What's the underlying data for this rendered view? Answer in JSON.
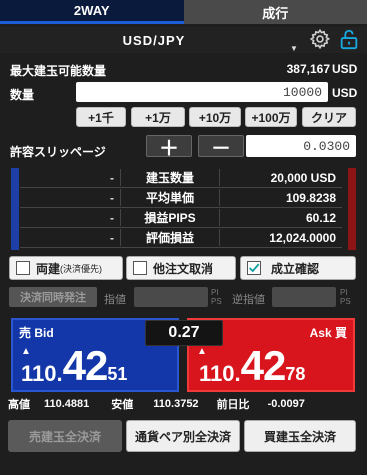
{
  "tabs": {
    "two_way": "2WAY",
    "market": "成行"
  },
  "pair": {
    "name": "USD/JPY"
  },
  "colors": {
    "bid": "#1337a8",
    "ask": "#d8141c",
    "tab_active": "#1c5cd8"
  },
  "icons": {
    "settings": "gear-icon",
    "lock": "lock-open-icon"
  },
  "max_qty": {
    "label": "最大建玉可能数量",
    "value": "387,167",
    "unit": "USD"
  },
  "qty": {
    "label": "数量",
    "value": "10000",
    "unit": "USD",
    "buttons": [
      "+1千",
      "+1万",
      "+10万",
      "+100万"
    ],
    "clear": "クリア"
  },
  "slippage": {
    "label": "許容スリッページ",
    "plus": "＋",
    "minus": "－",
    "value": "0.0300"
  },
  "info": [
    {
      "dash": "-",
      "label": "建玉数量",
      "value": "20,000 USD"
    },
    {
      "dash": "-",
      "label": "平均単価",
      "value": "109.8238"
    },
    {
      "dash": "-",
      "label": "損益PIPS",
      "value": "60.12"
    },
    {
      "dash": "-",
      "label": "評価損益",
      "value": "12,024.0000"
    }
  ],
  "options": {
    "both": {
      "label": "両建",
      "sub": "(決済優先)",
      "checked": false
    },
    "cancel_other": {
      "label": "他注文取消",
      "checked": false
    },
    "confirm": {
      "label": "成立確認",
      "checked": true
    }
  },
  "simultaneous": {
    "button": "決済同時発注",
    "limit": "指値",
    "stop": "逆指値",
    "pips_p": "PI",
    "pips_s": "PS"
  },
  "bid": {
    "label": "売 Bid",
    "small": "110.",
    "big": "42",
    "pip": "51"
  },
  "ask": {
    "label": "Ask 買",
    "small": "110.",
    "big": "42",
    "pip": "78"
  },
  "spread": "0.27",
  "stats": {
    "high_label": "高値",
    "high": "110.4881",
    "low_label": "安値",
    "low": "110.3752",
    "change_label": "前日比",
    "change": "-0.0097"
  },
  "bottom": {
    "sell_all": "売建玉全決済",
    "pair_all": "通貨ペア別全決済",
    "buy_all": "買建玉全決済"
  }
}
